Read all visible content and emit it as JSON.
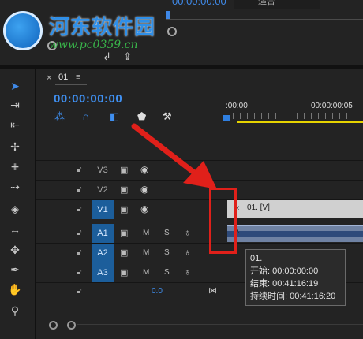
{
  "top_panel": {
    "timecode": "00:00:00:00",
    "dropdown_value": "适合"
  },
  "watermark": {
    "title": "河东软件园",
    "url": "www.pc0359.cn"
  },
  "sequence_tab": {
    "name": "01"
  },
  "timeline": {
    "timecode": "00:00:00:00",
    "ruler_labels": [
      ":00:00",
      "00:00:00:05"
    ]
  },
  "tracks": [
    {
      "name": "V3",
      "type": "video",
      "selected": false
    },
    {
      "name": "V2",
      "type": "video",
      "selected": false
    },
    {
      "name": "V1",
      "type": "video",
      "selected": true
    },
    {
      "name": "A1",
      "type": "audio",
      "selected": true,
      "mute_label": "M",
      "solo_label": "S"
    },
    {
      "name": "A2",
      "type": "audio",
      "selected": true,
      "mute_label": "M",
      "solo_label": "S"
    },
    {
      "name": "A3",
      "type": "audio",
      "selected": true,
      "mute_label": "M",
      "solo_label": "S"
    }
  ],
  "master": {
    "volume": "0.0"
  },
  "clips": {
    "video_label": "01. [V]",
    "fx_badge": "fx"
  },
  "tooltip": {
    "title": "01.",
    "start": "开始: 00:00:00:00",
    "end": "结束: 00:41:16:19",
    "duration": "持续时间: 00:41:16:20"
  },
  "colors": {
    "accent_blue": "#3f8ff0",
    "selected_track": "#1c5e9b",
    "work_area": "#e6d300",
    "annotation_red": "#e0201a"
  },
  "icons": {
    "tools": [
      "selection-tool-icon",
      "track-select-icon",
      "ripple-edit-icon",
      "rolling-edit-icon",
      "rate-stretch-icon",
      "razor-icon",
      "slip-icon",
      "slide-icon",
      "pen-icon",
      "hand-icon",
      "zoom-icon"
    ]
  }
}
